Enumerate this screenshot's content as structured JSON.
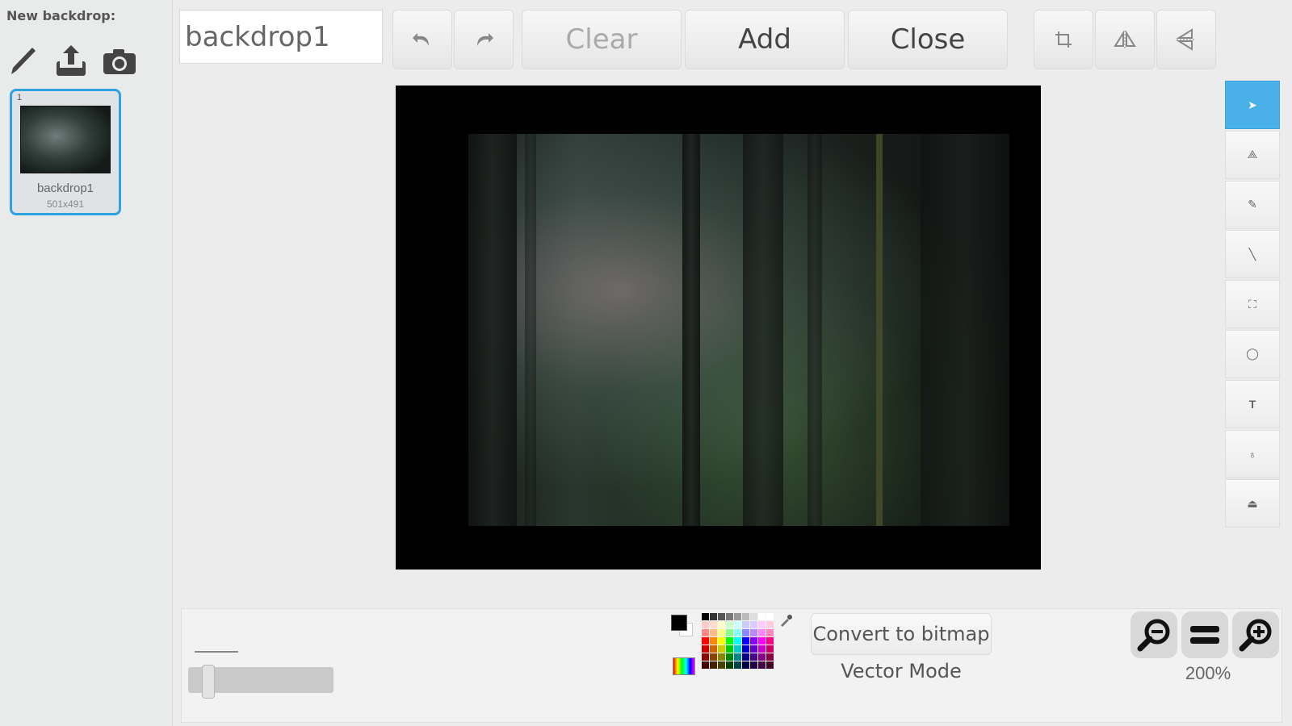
{
  "left_panel": {
    "new_label": "New backdrop:",
    "icons": [
      "paintbrush-icon",
      "upload-icon",
      "camera-icon"
    ],
    "backdrops": [
      {
        "number": "1",
        "name": "backdrop1",
        "size": "501x491"
      }
    ]
  },
  "toolbar": {
    "name_value": "backdrop1",
    "clear_label": "Clear",
    "add_label": "Add",
    "close_label": "Close"
  },
  "tools": [
    "select",
    "reshape",
    "pencil",
    "line",
    "rectangle",
    "ellipse",
    "text",
    "fill",
    "stamp"
  ],
  "bottom": {
    "convert_label": "Convert to bitmap",
    "mode_label": "Vector Mode",
    "zoom_label": "200%"
  },
  "colors": {
    "accent": "#4ab0e8",
    "foreground": "#000000",
    "background": "#ffffff"
  }
}
